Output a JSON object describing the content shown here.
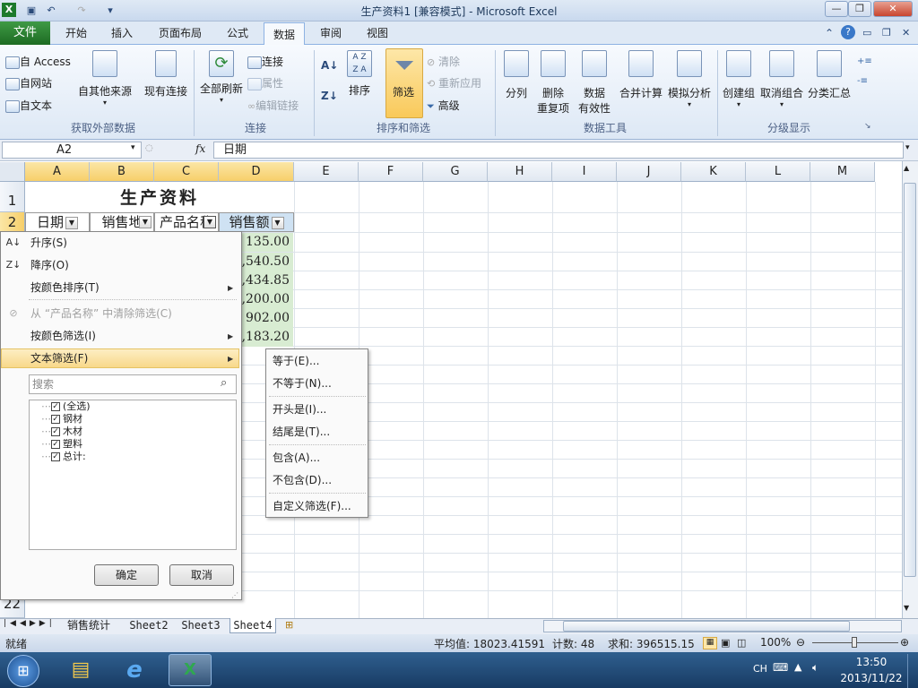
{
  "window": {
    "title": "生产资料1  [兼容模式] - Microsoft Excel"
  },
  "tabs": [
    "文件",
    "开始",
    "插入",
    "页面布局",
    "公式",
    "数据",
    "审阅",
    "视图"
  ],
  "active_tab": "数据",
  "ribbon": {
    "get_external": {
      "access": "自 Access",
      "web": "自网站",
      "text": "自文本",
      "other": "自其他来源",
      "existing": "现有连接",
      "group": "获取外部数据"
    },
    "connections": {
      "refresh_all": "全部刷新",
      "connections": "连接",
      "properties": "属性",
      "edit_links": "编辑链接",
      "group": "连接"
    },
    "sort_filter": {
      "sort": "排序",
      "filter": "筛选",
      "clear": "清除",
      "reapply": "重新应用",
      "advanced": "高级",
      "group": "排序和筛选"
    },
    "data_tools": {
      "text_to_columns": "分列",
      "remove_dup_1": "删除",
      "remove_dup_2": "重复项",
      "validation_1": "数据",
      "validation_2": "有效性",
      "consolidate": "合并计算",
      "what_if": "模拟分析",
      "group": "数据工具"
    },
    "outline": {
      "group_btn": "创建组",
      "ungroup": "取消组合",
      "subtotal": "分类汇总",
      "group": "分级显示"
    }
  },
  "formula_bar": {
    "name_box": "A2",
    "fx": "fx",
    "value": "日期"
  },
  "columns": [
    "A",
    "B",
    "C",
    "D",
    "E",
    "F",
    "G",
    "H",
    "I",
    "J",
    "K",
    "L",
    "M"
  ],
  "rows": [
    "1",
    "2",
    "22"
  ],
  "sheet": {
    "title": "生产资料",
    "headers": [
      "日期",
      "销售地",
      "产品名称",
      "销售额"
    ],
    "values": [
      "135.00",
      "1,540.50",
      "1,434.85",
      "1,200.00",
      "902.00",
      "2,183.20"
    ]
  },
  "filter_menu": {
    "sort_asc": "升序(S)",
    "sort_desc": "降序(O)",
    "sort_color": "按颜色排序(T)",
    "clear": "从 “产品名称” 中清除筛选(C)",
    "filter_color": "按颜色筛选(I)",
    "text_filter": "文本筛选(F)",
    "search_placeholder": "搜索",
    "items": [
      "(全选)",
      "钢材",
      "木材",
      "塑料",
      "总计:"
    ],
    "ok": "确定",
    "cancel": "取消"
  },
  "text_filter_submenu": [
    "等于(E)...",
    "不等于(N)...",
    "开头是(I)...",
    "结尾是(T)...",
    "包含(A)...",
    "不包含(D)...",
    "自定义筛选(F)..."
  ],
  "sheet_tabs": [
    "销售统计",
    "Sheet2",
    "Sheet3",
    "Sheet4"
  ],
  "status": {
    "ready": "就绪",
    "average": "平均值: 18023.41591",
    "count": "计数: 48",
    "sum": "求和: 396515.15",
    "zoom": "100%"
  },
  "taskbar": {
    "lang": "CH",
    "time": "13:50",
    "date": "2013/11/22"
  }
}
